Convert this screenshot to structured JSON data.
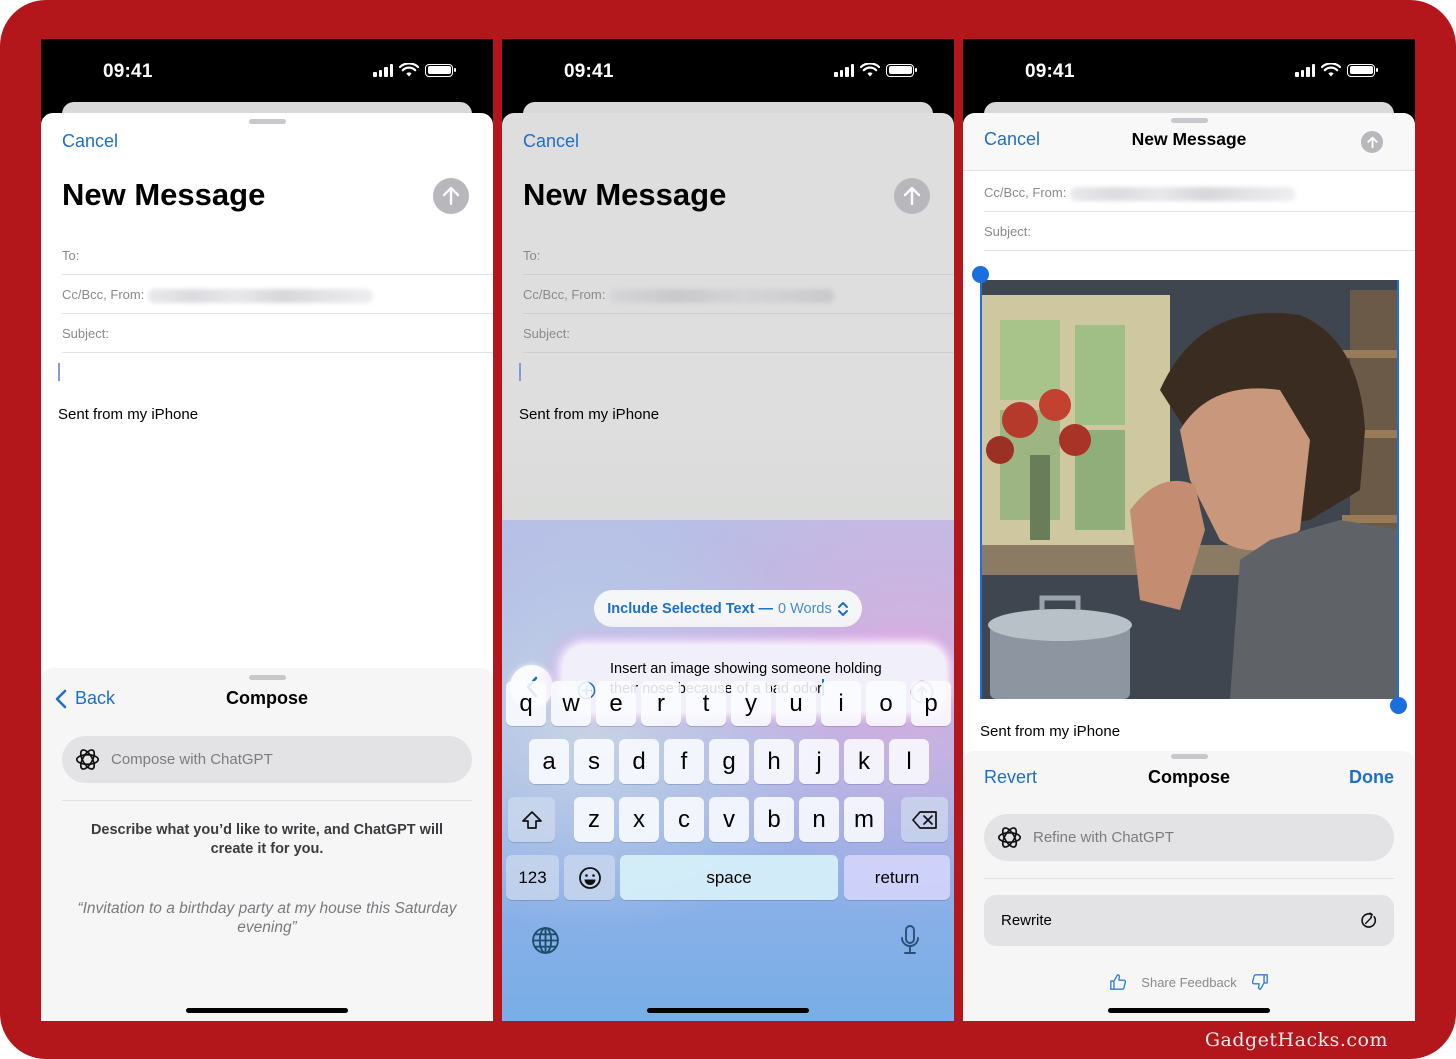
{
  "brand": {
    "frame_color": "#b3171c",
    "accent": "#1f6fc5",
    "watermark": "GadgetHacks.com"
  },
  "status_bar": {
    "time": "09:41"
  },
  "screens": [
    {
      "mail": {
        "cancel": "Cancel",
        "title": "New Message",
        "to_label": "To:",
        "cc_label": "Cc/Bcc, From:",
        "subject_label": "Subject:",
        "signature": "Sent from my iPhone"
      },
      "compose": {
        "back": "Back",
        "title": "Compose",
        "input_placeholder": "Compose with ChatGPT",
        "description": "Describe what you’d like to write, and ChatGPT will create it for you.",
        "example": "“Invitation to a birthday party at my house this Saturday evening”"
      }
    },
    {
      "mail": {
        "cancel": "Cancel",
        "title": "New Message",
        "to_label": "To:",
        "cc_label": "Cc/Bcc, From:",
        "subject_label": "Subject:",
        "signature": "Sent from my iPhone"
      },
      "include_selector": {
        "label": "Include Selected Text —",
        "value": "0 Words"
      },
      "prompt": {
        "text": "Insert an image showing someone holding their nose because of a bad odor"
      },
      "keyboard": {
        "row1": [
          "q",
          "w",
          "e",
          "r",
          "t",
          "y",
          "u",
          "i",
          "o",
          "p"
        ],
        "row2": [
          "a",
          "s",
          "d",
          "f",
          "g",
          "h",
          "j",
          "k",
          "l"
        ],
        "row3": [
          "z",
          "x",
          "c",
          "v",
          "b",
          "n",
          "m"
        ],
        "numbers": "123",
        "space": "space",
        "return": "return"
      }
    },
    {
      "mail": {
        "cancel": "Cancel",
        "title": "New Message",
        "cc_label": "Cc/Bcc, From:",
        "subject_label": "Subject:",
        "image_alt": "Man in a kitchen holding his nose near a trash can",
        "signature": "Sent from my iPhone"
      },
      "compose": {
        "revert": "Revert",
        "title": "Compose",
        "done": "Done",
        "input_placeholder": "Refine with ChatGPT",
        "rewrite": "Rewrite",
        "feedback": "Share Feedback"
      }
    }
  ]
}
